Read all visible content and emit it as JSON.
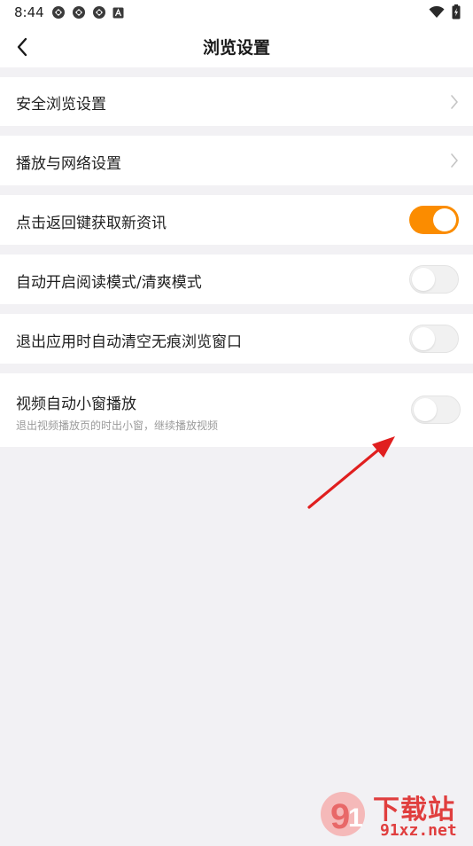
{
  "status_bar": {
    "time": "8:44",
    "left_icons": [
      "sync-icon",
      "sync-icon",
      "sync-icon",
      "text-a-icon"
    ],
    "right_icons": [
      "wifi-icon",
      "battery-icon"
    ]
  },
  "header": {
    "title": "浏览设置",
    "back_icon": "chevron-left-icon"
  },
  "settings": {
    "safe_browsing": {
      "label": "安全浏览设置"
    },
    "playback_network": {
      "label": "播放与网络设置"
    },
    "back_key_refresh": {
      "label": "点击返回键获取新资讯",
      "enabled": true
    },
    "auto_reading_mode": {
      "label": "自动开启阅读模式/清爽模式",
      "enabled": false
    },
    "auto_clear_incognito": {
      "label": "退出应用时自动清空无痕浏览窗口",
      "enabled": false
    },
    "video_mini_window": {
      "label": "视频自动小窗播放",
      "description": "退出视频播放页的时出小窗，继续播放视频",
      "enabled": false
    }
  },
  "watermark": {
    "logo_text": "下载站",
    "domain": "91xz.net"
  },
  "colors": {
    "accent": "#fb8c00",
    "background": "#f2f1f4",
    "annotation_arrow": "#e01f1f"
  }
}
